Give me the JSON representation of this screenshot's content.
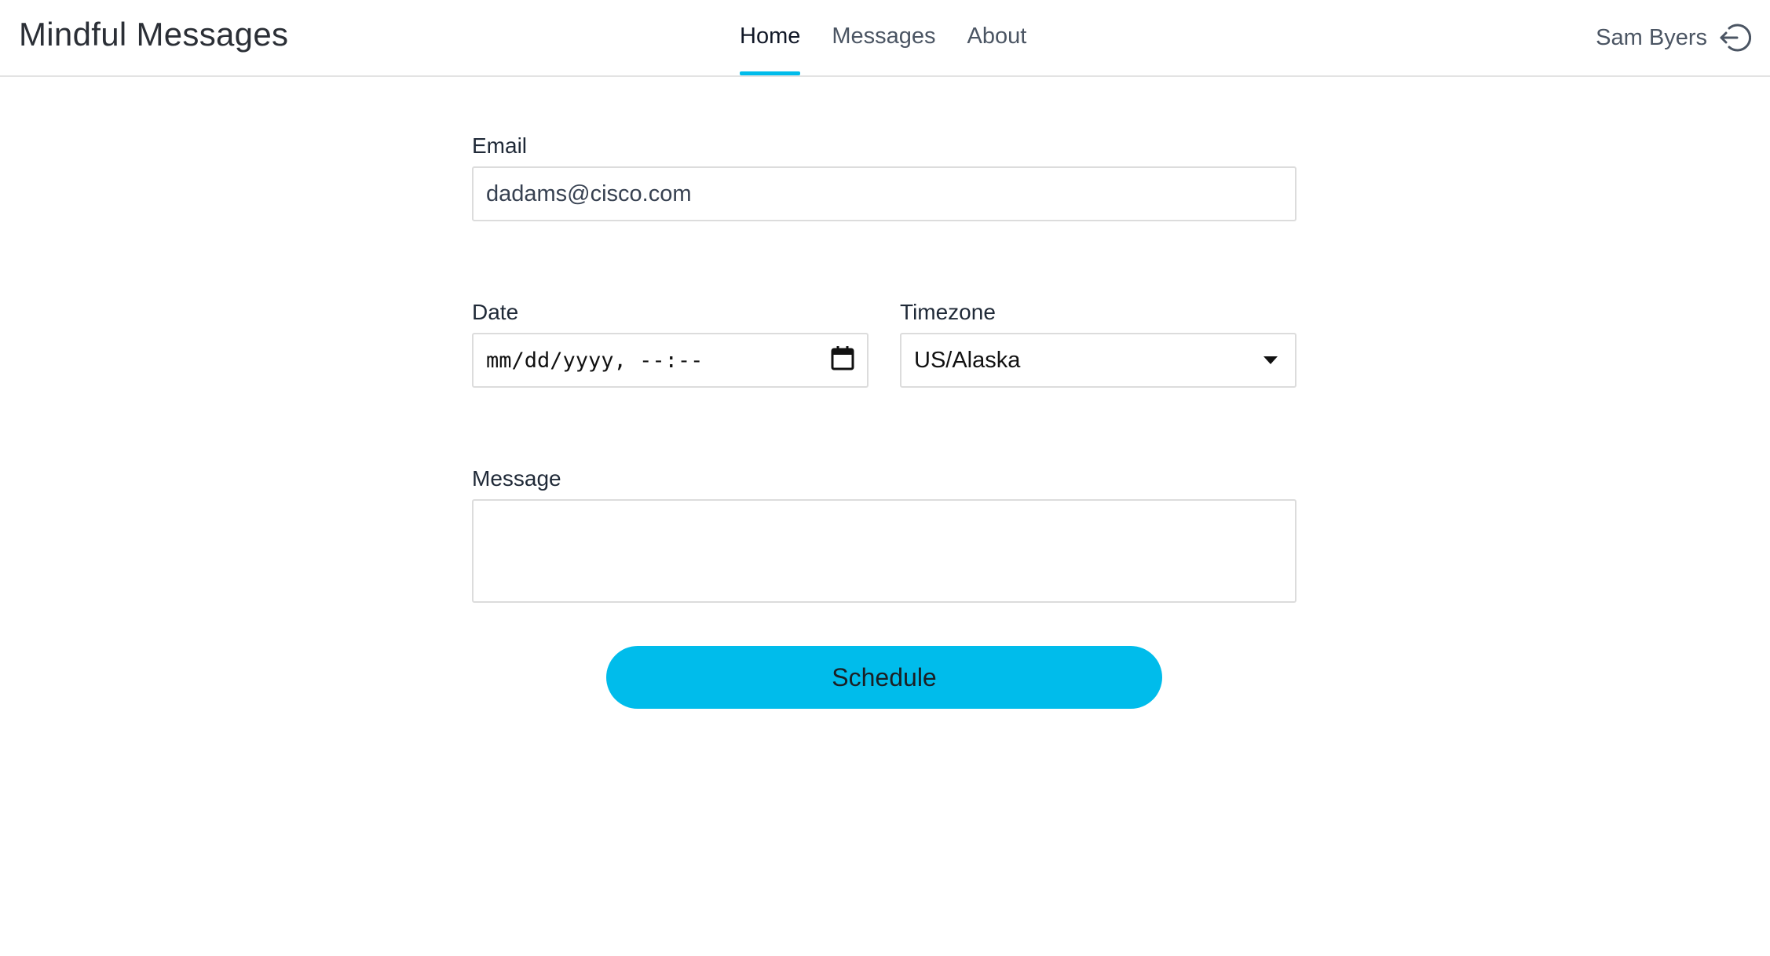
{
  "header": {
    "app_title": "Mindful Messages",
    "nav": [
      {
        "label": "Home",
        "active": true
      },
      {
        "label": "Messages",
        "active": false
      },
      {
        "label": "About",
        "active": false
      }
    ],
    "user_name": "Sam Byers",
    "logout_icon": "logout-icon"
  },
  "form": {
    "email": {
      "label": "Email",
      "value": "dadams@cisco.com"
    },
    "date": {
      "label": "Date",
      "placeholder": "mm/dd/yyyy, --:--",
      "icon": "calendar-icon"
    },
    "timezone": {
      "label": "Timezone",
      "value": "US/Alaska",
      "icon": "caret-down-icon"
    },
    "message": {
      "label": "Message",
      "value": ""
    },
    "submit_label": "Schedule"
  },
  "colors": {
    "accent": "#00bceb",
    "border": "#dcdcdc"
  }
}
